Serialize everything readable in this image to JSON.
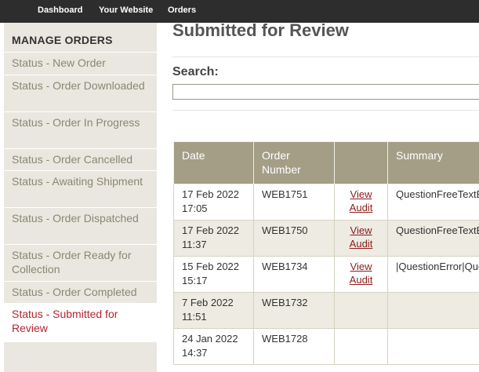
{
  "topnav": {
    "items": [
      {
        "label": "Dashboard"
      },
      {
        "label": "Your Website"
      },
      {
        "label": "Orders"
      }
    ]
  },
  "sidebar": {
    "heading": "MANAGE ORDERS",
    "items": [
      {
        "label": "Status - New Order"
      },
      {
        "label": "Status - Order Downloaded"
      },
      {
        "label": "Status - Order In Progress"
      },
      {
        "label": "Status - Order Cancelled"
      },
      {
        "label": "Status - Awaiting Shipment"
      },
      {
        "label": "Status - Order Dispatched"
      },
      {
        "label": "Status - Order Ready for Collection"
      },
      {
        "label": "Status - Order Completed"
      },
      {
        "label": "Status - Submitted for Review",
        "active": true
      }
    ]
  },
  "main": {
    "title": "Submitted for Review",
    "search": {
      "label": "Search:",
      "value": "",
      "placeholder": ""
    }
  },
  "table": {
    "headers": {
      "date": "Date",
      "order_number": "Order Number",
      "actions": "",
      "summary": "Summary"
    },
    "view_audit_label": "View Audit",
    "rows": [
      {
        "date": "17 Feb 2022 17:05",
        "order": "WEB1751",
        "audit": true,
        "summary": "QuestionFreeTextE"
      },
      {
        "date": "17 Feb 2022 11:37",
        "order": "WEB1750",
        "audit": true,
        "summary": "QuestionFreeTextE"
      },
      {
        "date": "15 Feb 2022 15:17",
        "order": "WEB1734",
        "audit": true,
        "summary": "|QuestionError|Que"
      },
      {
        "date": "7 Feb 2022 11:51",
        "order": "WEB1732",
        "audit": false,
        "summary": ""
      },
      {
        "date": "24 Jan 2022 14:37",
        "order": "WEB1728",
        "audit": false,
        "summary": ""
      }
    ]
  },
  "colors": {
    "topbar": "#2d2d2d",
    "sidebar_bg": "#e9e7df",
    "sidebar_text": "#8a8775",
    "active_text": "#b8232f",
    "table_header": "#a49e87",
    "row_alt": "#edebe2",
    "link": "#8a1c1c"
  }
}
